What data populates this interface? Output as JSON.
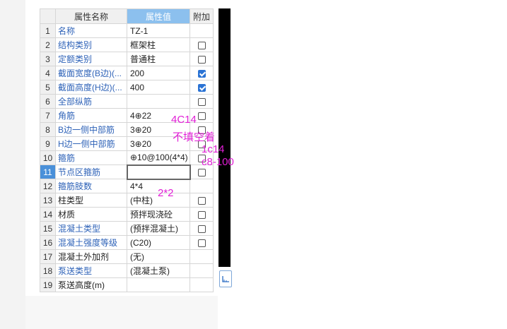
{
  "table": {
    "headers": {
      "rownum": "",
      "name": "属性名称",
      "value": "属性值",
      "extra": "附加"
    },
    "rows": [
      {
        "num": "1",
        "name": "名称",
        "value": "TZ-1",
        "check": null
      },
      {
        "num": "2",
        "name": "结构类别",
        "value": "框架柱",
        "check": false
      },
      {
        "num": "3",
        "name": "定额类别",
        "value": "普通柱",
        "check": false
      },
      {
        "num": "4",
        "name": "截面宽度(B边)(...",
        "value": "200",
        "check": true
      },
      {
        "num": "5",
        "name": "截面高度(H边)(...",
        "value": "400",
        "check": true
      },
      {
        "num": "6",
        "name": "全部纵筋",
        "value": "",
        "check": false
      },
      {
        "num": "7",
        "name": "角筋",
        "value": "4⊕22",
        "check": false
      },
      {
        "num": "8",
        "name": "B边一侧中部筋",
        "value": "3⊕20",
        "check": false
      },
      {
        "num": "9",
        "name": "H边一侧中部筋",
        "value": "3⊕20",
        "check": false
      },
      {
        "num": "10",
        "name": "箍筋",
        "value": "⊕10@100(4*4)",
        "check": false
      },
      {
        "num": "11",
        "name": "节点区箍筋",
        "value": "",
        "check": false
      },
      {
        "num": "12",
        "name": "箍筋肢数",
        "value": "4*4",
        "check": null
      },
      {
        "num": "13",
        "name": "柱类型",
        "value": "(中柱)",
        "check": false
      },
      {
        "num": "14",
        "name": "材质",
        "value": "预拌现浇砼",
        "check": false
      },
      {
        "num": "15",
        "name": "混凝土类型",
        "value": "(预拌混凝土)",
        "check": false
      },
      {
        "num": "16",
        "name": "混凝土强度等级",
        "value": "(C20)",
        "check": false
      },
      {
        "num": "17",
        "name": "混凝土外加剂",
        "value": "(无)",
        "check": null
      },
      {
        "num": "18",
        "name": "泵送类型",
        "value": "(混凝土泵)",
        "check": null
      },
      {
        "num": "19",
        "name": "泵送高度(m)",
        "value": "",
        "check": null
      }
    ]
  },
  "annotations": {
    "a1": "4C14",
    "a2": "不填空着",
    "a3": "1c14",
    "a4": "c8-100",
    "a5": "2*2"
  },
  "colors": {
    "annotation": "#e11fd6",
    "header_value": "#8cc0ee",
    "link": "#2f63b8",
    "active_row": "#4a90d9"
  }
}
